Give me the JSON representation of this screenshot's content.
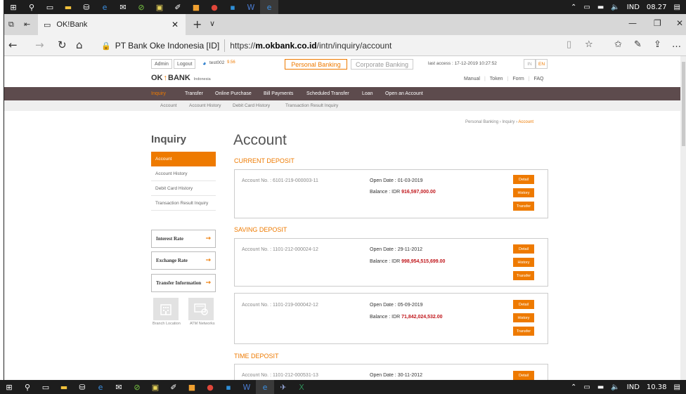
{
  "taskbar_top": {
    "lang": "IND",
    "time": "08.27"
  },
  "taskbar_bottom": {
    "lang": "IND",
    "time": "10.38"
  },
  "browser": {
    "tab_title": "OK!Bank",
    "site_name": "PT Bank Oke Indonesia [ID]",
    "url_prefix": "https://",
    "url_domain": "m.okbank.co.id",
    "url_path": "/intn/inquiry/account"
  },
  "header": {
    "admin": "Admin",
    "logout": "Logout",
    "user": "test002",
    "user_points": "9.56",
    "personal": "Personal Banking",
    "corporate": "Corporate Banking",
    "last_access": "last access : 17-12-2019 10:27:52",
    "lang_in": "IN",
    "lang_en": "EN",
    "logo_ok": "OK",
    "logo_bank": "BANK",
    "logo_sub": "Indonesia",
    "links": [
      "Manual",
      "Token",
      "Form",
      "FAQ"
    ]
  },
  "menu": [
    "Inquiry",
    "Transfer",
    "Online Purchase",
    "Bill Payments",
    "Scheduled Transfer",
    "Loan",
    "Open an Account"
  ],
  "submenu": [
    "Account",
    "Account History",
    "Debit Card History",
    "Transaction Result Inquiry"
  ],
  "breadcrumb": {
    "a": "Personal Banking",
    "b": "Inquiry",
    "c": "Account"
  },
  "sidebar": {
    "title": "Inquiry",
    "items": [
      "Account",
      "Account History",
      "Debit Card History",
      "Transaction Result Inquiry"
    ],
    "boxes": [
      "Interest Rate",
      "Exchange Rate",
      "Transfer Information"
    ],
    "icons": [
      "Branch Location",
      "ATM Networks"
    ]
  },
  "page_title": "Account",
  "sections": {
    "current": "CURRENT DEPOSIT",
    "saving": "SAVING DEPOSIT",
    "time": "TIME DEPOSIT"
  },
  "buttons": {
    "detail": "Detail",
    "history": "History",
    "transfer": "Transfer"
  },
  "accounts": [
    {
      "no": "Account No. : 6101-219-000003-11",
      "open": "Open Date : 01-03-2019",
      "bal_label": "Balance : IDR ",
      "bal": "916,597,000.00"
    },
    {
      "no": "Account No. : 1101-212-000024-12",
      "open": "Open Date : 29-11-2012",
      "bal_label": "Balance : IDR ",
      "bal": "998,954,515,699.00"
    },
    {
      "no": "Account No. : 1101-219-000042-12",
      "open": "Open Date : 05-09-2019",
      "bal_label": "Balance : IDR ",
      "bal": "71,842,024,532.00"
    },
    {
      "no": "Account No. : 1101-212-000531-13",
      "open": "Open Date : 30-11-2012"
    }
  ]
}
